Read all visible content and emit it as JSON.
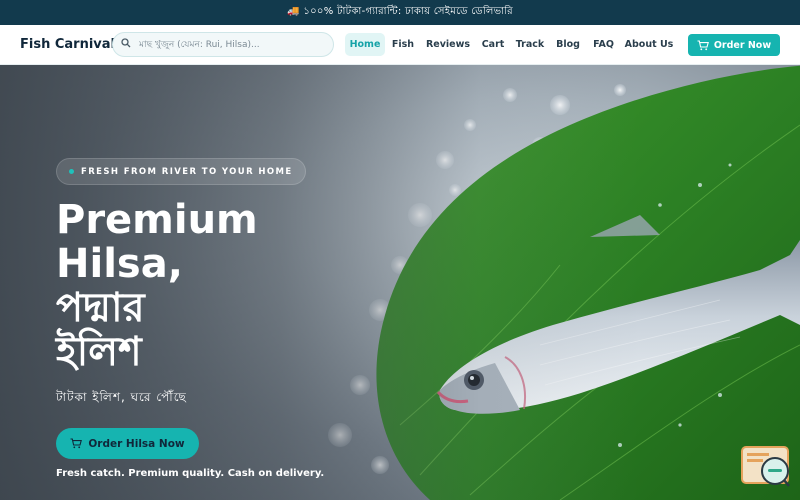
{
  "announcement": "🚚 ১০০% টাটকা-গ্যারান্টি: ঢাকায় সেইমডে ডেলিভারি",
  "nav": {
    "logo": "Fish Carnival",
    "search_placeholder": "মাছ খুঁজুন (যেমন: Rui, Hilsa)...",
    "links": [
      "Home",
      "Fish",
      "Reviews",
      "Cart",
      "Track",
      "Blog",
      "FAQ",
      "About Us"
    ],
    "active_link": "Home",
    "order_button": "Order Now"
  },
  "hero": {
    "badge": "FRESH FROM RIVER TO YOUR HOME",
    "headline_line1": "Premium",
    "headline_line2": "Hilsa,",
    "headline_line3": "পদ্মার",
    "headline_line4": "ইলিশ",
    "subheadline": "টাটকা ইলিশ, ঘরে পৌঁছে",
    "cta_button": "Order Hilsa Now",
    "tagline": "Fresh catch. Premium quality. Cash on delivery."
  },
  "icons": {
    "search": "search-icon",
    "cart": "cart-icon",
    "chat": "chat-widget-icon"
  },
  "colors": {
    "accent": "#16b4b0",
    "announce_bg": "#123a4d",
    "active_nav_bg": "#e1f5f5"
  }
}
